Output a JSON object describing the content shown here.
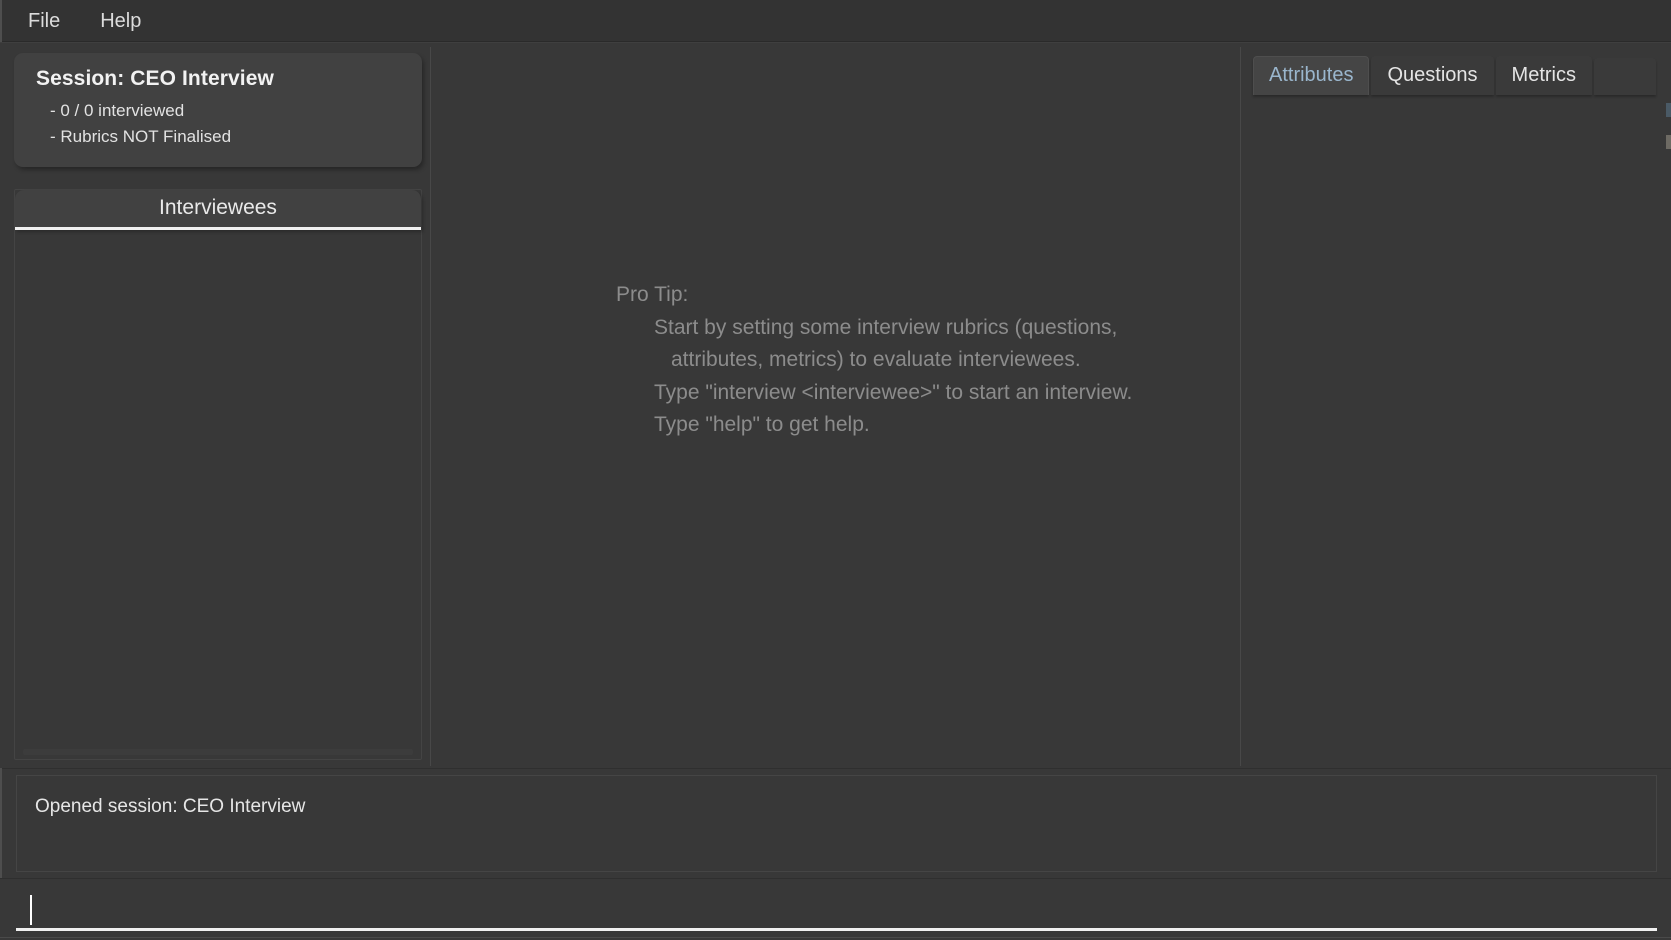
{
  "window": {
    "accent_color": "#9ab6cd",
    "background_color": "#383838",
    "panel_color": "#414141"
  },
  "menubar": {
    "items": [
      {
        "label": "File",
        "name": "menu-file"
      },
      {
        "label": "Help",
        "name": "menu-help"
      }
    ]
  },
  "sidebar": {
    "session_card": {
      "title": "Session: CEO Interview",
      "lines": [
        "- 0 / 0 interviewed",
        "- Rubrics NOT Finalised"
      ],
      "interviewed_count": "0",
      "interviewed_total": "0",
      "rubrics_status": "NOT Finalised"
    },
    "interviewees_panel": {
      "header": "Interviewees",
      "items": []
    }
  },
  "main": {
    "protip": {
      "title": "Pro Tip:",
      "lines": [
        "Start by setting some interview rubrics (questions,",
        "attributes, metrics) to evaluate interviewees.",
        "Type \"interview <interviewee>\" to start an interview.",
        "Type \"help\" to get help."
      ]
    }
  },
  "rubrics": {
    "tabs": [
      {
        "label": "Attributes",
        "name": "tab-attributes",
        "active": true
      },
      {
        "label": "Questions",
        "name": "tab-questions",
        "active": false
      },
      {
        "label": "Metrics",
        "name": "tab-metrics",
        "active": false
      }
    ],
    "active_tab": "Attributes",
    "content": ""
  },
  "log": {
    "lines": [
      "Opened session: CEO Interview"
    ]
  },
  "command_input": {
    "value": "",
    "placeholder": ""
  }
}
